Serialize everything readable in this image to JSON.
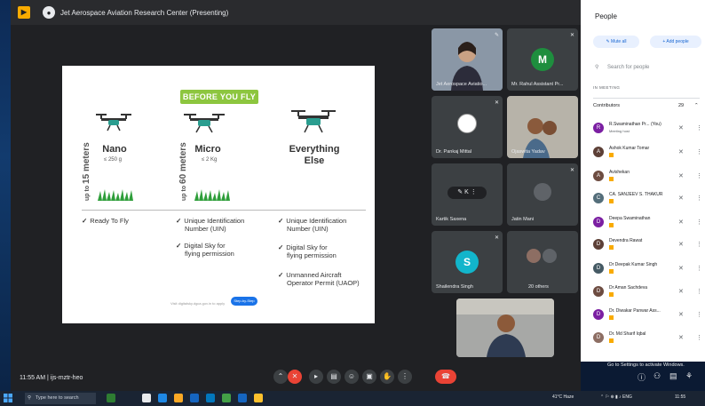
{
  "meet": {
    "title": "Jet Aerospace Aviation Research Center (Presenting)",
    "time": "11:55 AM",
    "separator": "|",
    "meeting_code": "ijs-mztr-heo",
    "end_label": ""
  },
  "slide": {
    "banner": "BEFORE YOU FLY",
    "categories": [
      {
        "title": "Nano",
        "sub": "≤ 250 g",
        "height_pre": "up to",
        "height_big": "15 meters"
      },
      {
        "title": "Micro",
        "sub": "≤ 2 Kg",
        "height_pre": "up to",
        "height_big": "60 meters"
      },
      {
        "title": "Everything",
        "title2": "Else",
        "sub": ""
      }
    ],
    "checks_col1": [
      "Ready To Fly"
    ],
    "checks_col2": [
      "Unique Identification",
      "Number (UIN)",
      "Digital Sky for",
      "flying permission"
    ],
    "checks_col3": [
      "Unique Identification",
      "Number (UIN)",
      "Digital Sky for",
      "flying permission",
      "Unmanned Aircraft",
      "Operator Permit (UAOP)"
    ],
    "tick": "✓",
    "footer_text": "Visit digitalsky.dgca.gov.in to apply",
    "footer_btn": "Step-by-Step"
  },
  "tiles": [
    {
      "name": "Jet Aerospace Aviatio...",
      "type": "video"
    },
    {
      "name": "Mr. Rahul Assistant Pr...",
      "type": "avatar",
      "letter": "M",
      "color": "#1e8e3e"
    },
    {
      "name": "Dr. Pankaj Mittal",
      "type": "logo"
    },
    {
      "name": "Ojaswita Yadav",
      "type": "video"
    },
    {
      "name": "Kartik Saxena",
      "type": "video"
    },
    {
      "name": "Jatin Mani",
      "type": "video"
    },
    {
      "name": "Shailendra Singh",
      "type": "avatar",
      "letter": "S",
      "color": "#12b5cb"
    },
    {
      "name": "20 others",
      "type": "others"
    }
  ],
  "people": {
    "title": "People",
    "mute_all": "Mute all",
    "add_people": "Add people",
    "search_placeholder": "Search for people",
    "section": "IN MEETING",
    "contributors": "Contributors",
    "count": "29",
    "list": [
      {
        "name": "R.Swaminathan Pr... (You)",
        "sub": "Meeting host",
        "letter": "R",
        "color": "#7b1fa2"
      },
      {
        "name": "Ashok Kumar Tomar",
        "sub": "",
        "letter": "A",
        "color": "#5d4037"
      },
      {
        "name": "Avishekan",
        "sub": "",
        "letter": "A",
        "color": "#6d4c41"
      },
      {
        "name": "CA. SANJEEV S. THAKUR",
        "sub": "",
        "letter": "C",
        "color": "#546e7a"
      },
      {
        "name": "Deepa Swaminathan",
        "sub": "",
        "letter": "D",
        "color": "#7b1fa2"
      },
      {
        "name": "Devendra Rawat",
        "sub": "",
        "letter": "D",
        "color": "#5d4037"
      },
      {
        "name": "Dr Deepak Kumar Singh",
        "sub": "",
        "letter": "D",
        "color": "#455a64"
      },
      {
        "name": "Dr Aman Sachdeva",
        "sub": "",
        "letter": "D",
        "color": "#6d4c41"
      },
      {
        "name": "Dr. Diwakar Panwar Ass...",
        "sub": "",
        "letter": "D",
        "color": "#7b1fa2"
      },
      {
        "name": "Dr. Md Sharif Iqbal",
        "sub": "",
        "letter": "D",
        "color": "#8d6e63"
      }
    ]
  },
  "windows": {
    "activate": "Go to Settings to activate Windows.",
    "search_placeholder": "Type here to search",
    "tray_temp": "41°C Haze",
    "tray_time": "11:55"
  }
}
